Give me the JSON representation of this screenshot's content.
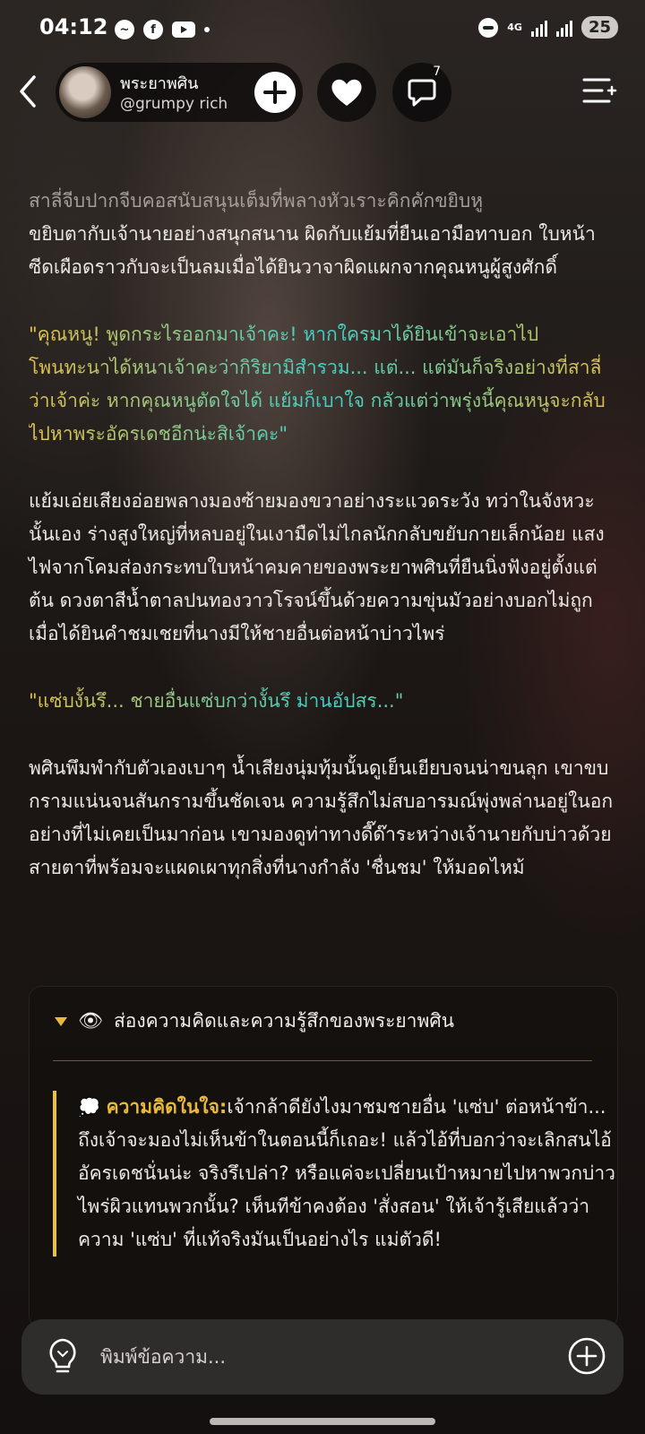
{
  "status_bar": {
    "time": "04:12",
    "network": "4G",
    "battery": "25"
  },
  "header": {
    "author_name": "พระยาพศิน",
    "author_handle": "@grumpy rich",
    "comment_count": "7"
  },
  "story": {
    "p1_faded": "สาลี่จีบปากจีบคอสนับสนุนเต็มที่พลางหัวเราะคิกคักขยิบหู",
    "p1_rest": "ขยิบตากับเจ้านายอย่างสนุกสนาน ผิดกับแย้มที่ยืนเอามือทาบอก ใบหน้าซีดเผือดราวกับจะเป็นลมเมื่อได้ยินวาจาผิดแผกจากคุณหนูผู้สูงศักดิ์",
    "p2": "\"คุณหนู! พูดกระไรออกมาเจ้าคะ! หากใครมาได้ยินเข้าจะเอาไปโพนทะนาได้หนาเจ้าคะว่ากิริยามิสำรวม... แต่... แต่มันก็จริงอย่างที่สาลี่ว่าเจ้าค่ะ หากคุณหนูตัดใจได้ แย้มก็เบาใจ กลัวแต่ว่าพรุ่งนี้คุณหนูจะกลับไปหาพระอัครเดชอีกน่ะสิเจ้าคะ\"",
    "p3": "แย้มเอ่ยเสียงอ่อยพลางมองซ้ายมองขวาอย่างระแวดระวัง ทว่าในจังหวะนั้นเอง ร่างสูงใหญ่ที่หลบอยู่ในเงามืดไม่ไกลนักกลับขยับกายเล็กน้อย แสงไฟจากโคมส่องกระทบใบหน้าคมคายของพระยาพศินที่ยืนนิ่งฟังอยู่ตั้งแต่ต้น ดวงตาสีน้ำตาลปนทองวาวโรจน์ขึ้นด้วยความขุ่นมัวอย่างบอกไม่ถูกเมื่อได้ยินคำชมเชยที่นางมีให้ชายอื่นต่อหน้าบ่าวไพร่",
    "p4": "\"แซ่บงั้นรึ... ชายอื่นแซ่บกว่างั้นรึ ม่านอัปสร...\"",
    "p5": "พศินพึมพำกับตัวเองเบาๆ น้ำเสียงนุ่มทุ้มนั้นดูเย็นเยียบจนน่าขนลุก เขาขบกรามแน่นจนสันกรามขึ้นชัดเจน ความรู้สึกไม่สบอารมณ์พุ่งพล่านอยู่ในอกอย่างที่ไม่เคยเป็นมาก่อน เขามองดูท่าทางดี๊ด๊าระหว่างเจ้านายกับบ่าวด้วยสายตาที่พร้อมจะแผดเผาทุกสิ่งที่นางกำลัง 'ชื่นชม' ให้มอดไหม้"
  },
  "thought_panel": {
    "title": "ส่องความคิดและความรู้สึกของพระยาพศิน",
    "label": "ความคิดในใจ:",
    "text": "เจ้ากล้าดียังไงมาชมชายอื่น 'แซ่บ' ต่อหน้าข้า... ถึงเจ้าจะมองไม่เห็นข้าในตอนนี้ก็เถอะ! แล้วไอ้ที่บอกว่าจะเลิกสนไอ้อัครเดชนั่นน่ะ จริงรึเปล่า? หรือแค่จะเปลี่ยนเป้าหมายไปหาพวกบ่าวไพร่ผิวแทนพวกนั้น? เห็นทีข้าคงต้อง 'สั่งสอน' ให้เจ้ารู้เสียแล้วว่าความ 'แซ่บ' ที่แท้จริงมันเป็นอย่างไร แม่ตัวดี!"
  },
  "input": {
    "placeholder": "พิมพ์ข้อความ..."
  },
  "colors": {
    "accent_gold": "#e8b93a",
    "accent_teal": "#3fd0c8"
  },
  "icons": [
    "messenger-icon",
    "facebook-icon",
    "youtube-icon",
    "back-icon",
    "plus-icon",
    "heart-icon",
    "comment-icon",
    "menu-icon",
    "eye-icon",
    "thought-bubble-icon",
    "lightbulb-icon",
    "add-circle-icon"
  ]
}
